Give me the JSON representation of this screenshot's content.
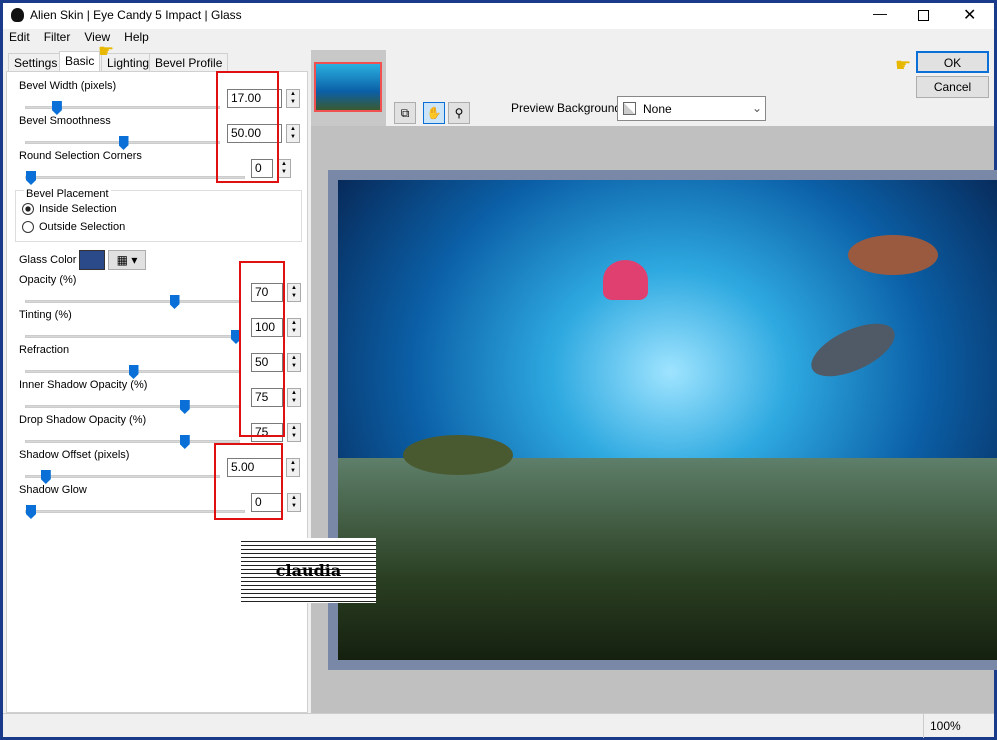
{
  "window": {
    "title": "Alien Skin | Eye Candy 5 Impact | Glass"
  },
  "menu": [
    "Edit",
    "Filter",
    "View",
    "Help"
  ],
  "tabs": [
    "Settings",
    "Basic",
    "Lighting",
    "Bevel Profile"
  ],
  "controls": [
    {
      "label": "Bevel Width (pixels)",
      "value": "17.00",
      "slider": 0.14
    },
    {
      "label": "Bevel Smoothness",
      "value": "50.00",
      "slider": 0.5
    },
    {
      "label": "Round Selection Corners",
      "value": "0",
      "slider": 0
    }
  ],
  "placement": {
    "title": "Bevel Placement",
    "inside": "Inside Selection",
    "outside": "Outside Selection",
    "selected": "inside"
  },
  "glass_color": {
    "label": "Glass Color",
    "color": "#2a4a8a"
  },
  "controls2": [
    {
      "label": "Opacity (%)",
      "value": "70",
      "slider": 0.7
    },
    {
      "label": "Tinting (%)",
      "value": "100",
      "slider": 1.0
    },
    {
      "label": "Refraction",
      "value": "50",
      "slider": 0.5
    },
    {
      "label": "Inner Shadow Opacity (%)",
      "value": "75",
      "slider": 0.75
    },
    {
      "label": "Drop Shadow Opacity (%)",
      "value": "75",
      "slider": 0.75
    },
    {
      "label": "Shadow Offset (pixels)",
      "value": "5.00",
      "slider": 0.08
    },
    {
      "label": "Shadow Glow",
      "value": "0",
      "slider": 0
    }
  ],
  "buttons": {
    "ok": "OK",
    "cancel": "Cancel"
  },
  "preview_bg": {
    "label": "Preview Background:",
    "value": "None"
  },
  "watermark": "claudia",
  "status": {
    "zoom": "100%"
  }
}
